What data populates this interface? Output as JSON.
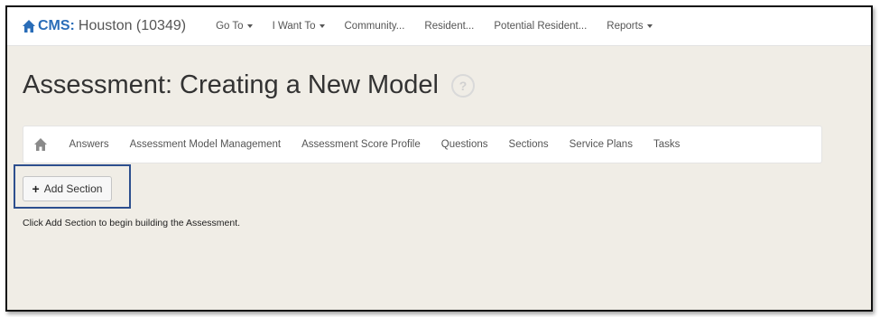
{
  "navbar": {
    "brand": "CMS:",
    "location": "Houston (10349)",
    "items": [
      {
        "label": "Go To",
        "dropdown": true
      },
      {
        "label": "I Want To",
        "dropdown": true
      },
      {
        "label": "Community...",
        "dropdown": false
      },
      {
        "label": "Resident...",
        "dropdown": false
      },
      {
        "label": "Potential Resident...",
        "dropdown": false
      },
      {
        "label": "Reports",
        "dropdown": true
      }
    ]
  },
  "page": {
    "title": "Assessment: Creating a New Model",
    "help": "?"
  },
  "subnav": {
    "items": [
      "Answers",
      "Assessment Model Management",
      "Assessment Score Profile",
      "Questions",
      "Sections",
      "Service Plans",
      "Tasks"
    ]
  },
  "actions": {
    "add_section_label": "Add Section",
    "add_icon": "plus"
  },
  "instruction": "Click Add Section to begin building the Assessment.",
  "colors": {
    "brand": "#2a6db8",
    "background": "#f0ede6",
    "highlight": "#2d4f8e"
  }
}
